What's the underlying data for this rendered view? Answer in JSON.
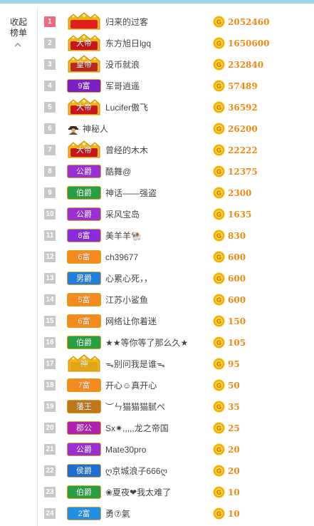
{
  "collapse": {
    "label": "收起榜单"
  },
  "rows": [
    {
      "rank": "1",
      "badge": "",
      "badge_kind": "crown",
      "badge_color": "#e11d1d",
      "name": "归来的过客",
      "amount": "2052460"
    },
    {
      "rank": "2",
      "badge": "大帝",
      "badge_kind": "crown",
      "badge_color": "#c8161d",
      "name": "东方旭日lgq",
      "amount": "1650600"
    },
    {
      "rank": "3",
      "badge": "皇帝",
      "badge_kind": "crown",
      "badge_color": "#b8281e",
      "name": "没币就浪",
      "amount": "232840"
    },
    {
      "rank": "4",
      "badge": "9富",
      "badge_kind": "plain",
      "badge_color": "#7c1fc9",
      "name": "军哥逍遥",
      "amount": "57489"
    },
    {
      "rank": "5",
      "badge": "大帝",
      "badge_kind": "crown",
      "badge_color": "#c8161d",
      "name": "Lucifer傲飞",
      "amount": "36592"
    },
    {
      "rank": "6",
      "badge": "",
      "badge_kind": "tiny",
      "badge_color": "#6b4f3a",
      "name": "神秘人",
      "amount": "26200"
    },
    {
      "rank": "7",
      "badge": "大帝",
      "badge_kind": "crown",
      "badge_color": "#c8161d",
      "name": "曾经的木木",
      "amount": "22222"
    },
    {
      "rank": "8",
      "badge": "公爵",
      "badge_kind": "plain",
      "badge_color": "#9a2fd6",
      "name": "酷舞@",
      "amount": "12375"
    },
    {
      "rank": "9",
      "badge": "伯爵",
      "badge_kind": "plain",
      "badge_color": "#27a043",
      "name": "神话——强盗",
      "amount": "2300"
    },
    {
      "rank": "10",
      "badge": "公爵",
      "badge_kind": "plain",
      "badge_color": "#9a2fd6",
      "name": "采风宝岛",
      "amount": "1635"
    },
    {
      "rank": "11",
      "badge": "8富",
      "badge_kind": "plain",
      "badge_color": "#8a2be2",
      "name": "美羊羊🐏",
      "amount": "830"
    },
    {
      "rank": "12",
      "badge": "6富",
      "badge_kind": "plain",
      "badge_color": "#f58a1f",
      "name": "ch39677",
      "amount": "600"
    },
    {
      "rank": "13",
      "badge": "男爵",
      "badge_kind": "plain",
      "badge_color": "#1f7fe0",
      "name": "心累心死，，",
      "amount": "600"
    },
    {
      "rank": "14",
      "badge": "5富",
      "badge_kind": "plain",
      "badge_color": "#f58a1f",
      "name": "江苏小鲨鱼",
      "amount": "600"
    },
    {
      "rank": "15",
      "badge": "6富",
      "badge_kind": "plain",
      "badge_color": "#f58a1f",
      "name": "网络让你着迷",
      "amount": "150"
    },
    {
      "rank": "16",
      "badge": "伯爵",
      "badge_kind": "plain",
      "badge_color": "#27a043",
      "name": "★★等你等了那么久★",
      "amount": "105"
    },
    {
      "rank": "17",
      "badge": "神",
      "badge_kind": "crown",
      "badge_color": "#e0a615",
      "name": "ᯓ别问我是谁ᯓ",
      "amount": "95"
    },
    {
      "rank": "18",
      "badge": "7富",
      "badge_kind": "plain",
      "badge_color": "#f58a1f",
      "name": "开心☺真开心",
      "amount": "50"
    },
    {
      "rank": "19",
      "badge": "藩王",
      "badge_kind": "plain",
      "badge_color": "#c0761a",
      "name": "︶ㄣ猫猫猫腻ぺ",
      "amount": "35"
    },
    {
      "rank": "20",
      "badge": "郡公",
      "badge_kind": "plain",
      "badge_color": "#b11fb3",
      "name": "Sx✷,,,,,龙之帝国",
      "amount": "25"
    },
    {
      "rank": "21",
      "badge": "公爵",
      "badge_kind": "plain",
      "badge_color": "#9a2fd6",
      "name": "Mate30pro",
      "amount": "20"
    },
    {
      "rank": "22",
      "badge": "侯爵",
      "badge_kind": "plain",
      "badge_color": "#1a6fd6",
      "name": "ღ京城浪子666ღ",
      "amount": "20"
    },
    {
      "rank": "23",
      "badge": "伯爵",
      "badge_kind": "plain",
      "badge_color": "#27a043",
      "name": "❀夏夜❤我太难了",
      "amount": "10"
    },
    {
      "rank": "24",
      "badge": "2富",
      "badge_kind": "plain",
      "badge_color": "#1e90e8",
      "name": "勇⑦氣",
      "amount": "10"
    }
  ],
  "colors": {
    "rank_first": "#f0697f",
    "rank_other": "#c8c8c8",
    "amount": "#f08a12",
    "coin": "#f6b800",
    "topbar": "#9ed3ec"
  }
}
